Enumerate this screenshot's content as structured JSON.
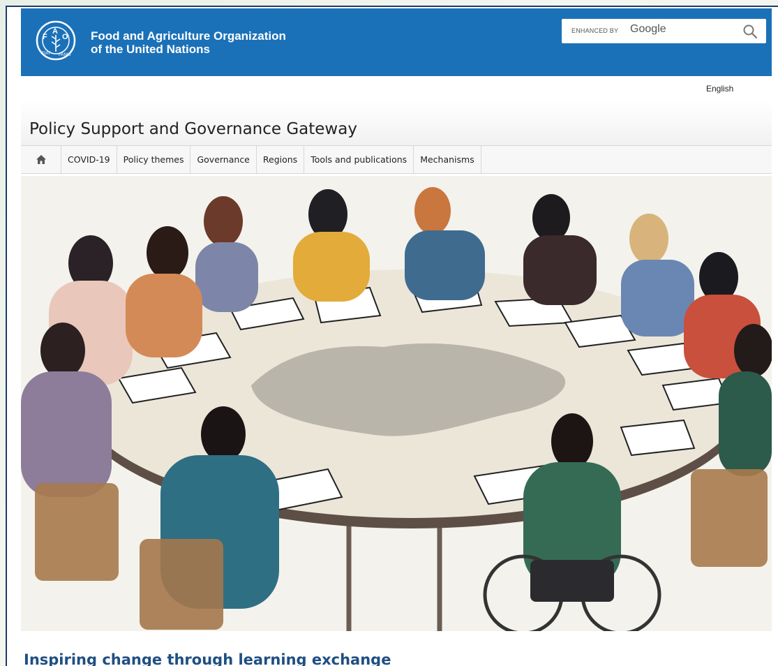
{
  "header": {
    "org_name_line1": "Food and Agriculture Organization",
    "org_name_line2": "of the United Nations",
    "logo_text_left": "FIAT",
    "logo_text_right": "PANIS",
    "search": {
      "enhanced_by": "ENHANCED BY",
      "provider": "Google",
      "icon": "search-icon"
    },
    "brand_color": "#1b71b8"
  },
  "language": "English",
  "site_title": "Policy Support and Governance Gateway",
  "nav": {
    "home_icon": "home-icon",
    "items": [
      "COVID-19",
      "Policy themes",
      "Governance",
      "Regions",
      "Tools and publications",
      "Mechanisms"
    ]
  },
  "hero": {
    "image_subject": "Illustration of a diverse group of people seated around a large round table reviewing documents"
  },
  "caption": "Inspiring change through learning exchange"
}
